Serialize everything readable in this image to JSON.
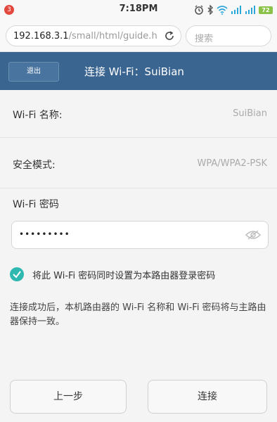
{
  "status_bar": {
    "notification_count": "3",
    "time": "7:18PM",
    "battery": "72",
    "icons": [
      "alarm-icon",
      "bluetooth-icon",
      "wifi-icon",
      "signal-icon",
      "signal-icon",
      "battery-icon"
    ]
  },
  "browser": {
    "url_host": "192.168.3.1",
    "url_path": "/small/html/guide.htm",
    "search_placeholder": "搜索"
  },
  "header": {
    "exit_label": "退出",
    "title": "连接 Wi-Fi：SuiBian",
    "background": "#3a6590"
  },
  "rows": [
    {
      "label": "Wi-Fi 名称:",
      "value": "SuiBian"
    },
    {
      "label": "安全模式:",
      "value": "WPA/WPA2-PSK"
    }
  ],
  "password": {
    "label": "Wi-Fi 密码",
    "value": "•••••••••"
  },
  "checkbox": {
    "checked": true,
    "label": "将此 Wi-Fi 密码同时设置为本路由器登录密码",
    "accent": "#2fb8b0"
  },
  "note": "连接成功后，本机路由器的 Wi-Fi 名称和 Wi-Fi 密码将与主路由器保持一致。",
  "buttons": {
    "prev": "上一步",
    "connect": "连接"
  }
}
